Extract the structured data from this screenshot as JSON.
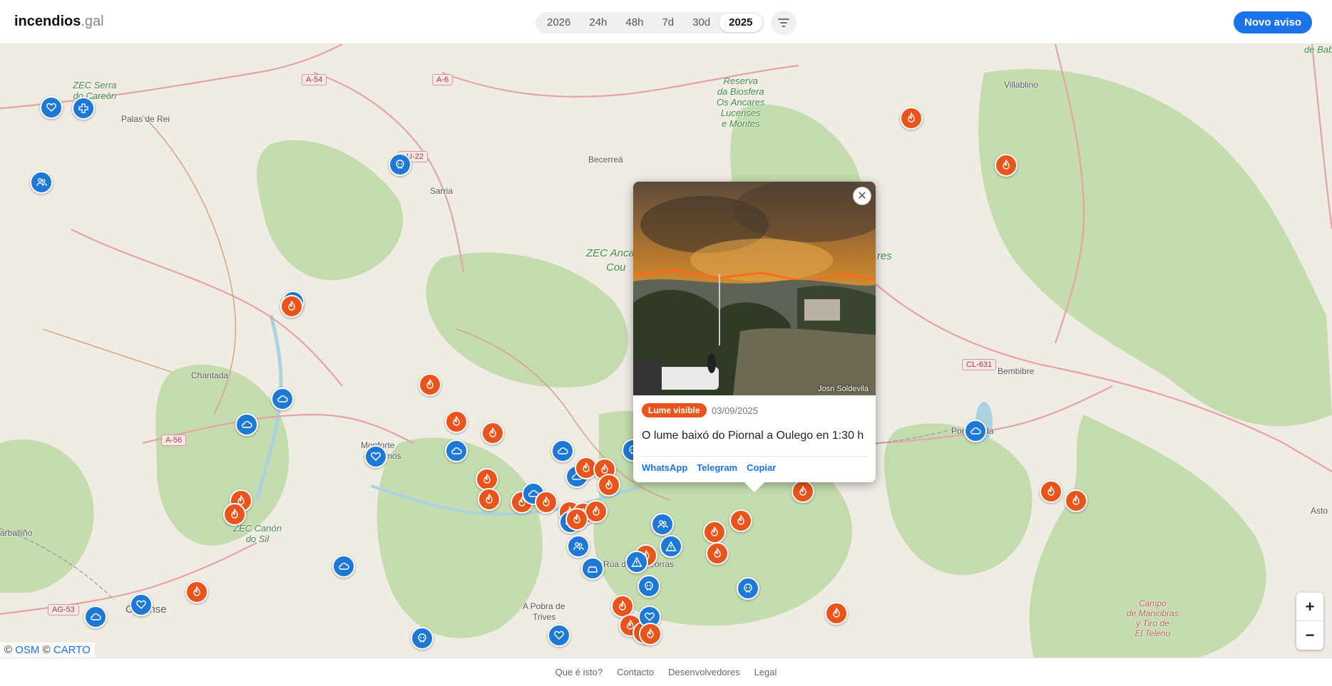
{
  "header": {
    "brand_main": "incendios",
    "brand_suffix": ".gal",
    "ranges": [
      {
        "label": "2026",
        "active": false
      },
      {
        "label": "24h",
        "active": false
      },
      {
        "label": "48h",
        "active": false
      },
      {
        "label": "7d",
        "active": false
      },
      {
        "label": "30d",
        "active": false
      },
      {
        "label": "2025",
        "active": true
      }
    ],
    "filter_icon": "filter-icon",
    "new_button": "Novo aviso"
  },
  "map": {
    "places": {
      "palas": "Palas de Rei",
      "sarria": "Sarria",
      "becerrea": "Becerreá",
      "chantada": "Chantada",
      "monforte1": "Monforte",
      "monforte2": "de Lemos",
      "carballino": "arballiño",
      "ourense": "Ourense",
      "pobra1": "A Pobra de",
      "pobra2": "Trives",
      "rua": "Rúa de Valdeorras",
      "villablino": "Villablino",
      "bembibre": "Bembibre",
      "ponferrada": "Ponferrada",
      "astorga": "Asto"
    },
    "parks": {
      "serra1": "ZEC Serra",
      "serra2": "do Careón",
      "biosfera": [
        "Reserva",
        "da Biosfera",
        "Os Ancares",
        "Lucenses",
        "e Montes"
      ],
      "zec_ancares1": "ZEC Anca",
      "zec_ancares2": "Cou",
      "ancares_side1": "res",
      "canon1": "ZEC Canón",
      "canon2": "do Sil",
      "babia1": "de Babi",
      "campo": [
        "Campo",
        "de Maniobras",
        "y Tiro de",
        "El Teleno"
      ]
    },
    "roads": {
      "a54": "A-54",
      "a6": "A-6",
      "lu": "LU-22",
      "a56": "A-56",
      "ag53": "AG-53",
      "cl631": "CL-631"
    },
    "zoom_in": "+",
    "zoom_out": "−",
    "attribution": {
      "prefix": "©",
      "osm": "OSM",
      "mid": "©",
      "carto": "CARTO"
    },
    "colors": {
      "fire": "#e8541b",
      "info": "#1e78d6",
      "accent": "#1a73e8"
    }
  },
  "popup": {
    "photo_credit": "Josn Soldevila",
    "badge": "Lume visible",
    "date": "03/09/2025",
    "text": "O lume baixó do Piornal a Oulego en 1:30 h",
    "links": {
      "whatsapp": "WhatsApp",
      "telegram": "Telegram",
      "copy": "Copiar"
    },
    "close_icon": "close-icon"
  },
  "footer": {
    "links": [
      "Que é isto?",
      "Contacto",
      "Desenvolvedores",
      "Legal"
    ]
  }
}
